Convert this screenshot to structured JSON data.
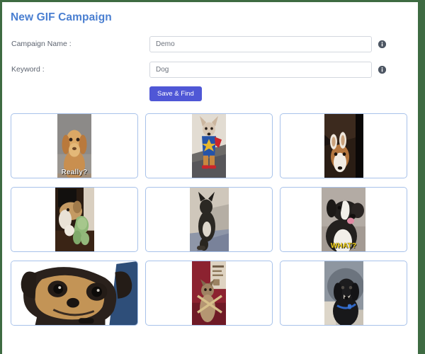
{
  "page": {
    "title": "New GIF Campaign",
    "frame_color": "#3e6b42",
    "title_color": "#4a7fd1",
    "accent_button_color": "#4f57d6",
    "card_border_color": "#a8c2ea"
  },
  "form": {
    "fields": [
      {
        "label": "Campaign Name :",
        "value": "Demo",
        "placeholder": "Demo",
        "info_icon": "info-circle-icon"
      },
      {
        "label": "Keyword :",
        "value": "Dog",
        "placeholder": "Dog",
        "info_icon": "info-circle-icon"
      }
    ],
    "submit_label": "Save & Find"
  },
  "results": {
    "cards": [
      {
        "id": "gif-1",
        "alt": "Tan vizsla puppy looking at camera",
        "caption": "Really?",
        "caption_style": "white",
        "thumb_width": "narrow"
      },
      {
        "id": "gif-2",
        "alt": "Chihuahua wearing superman costume on stairs",
        "caption": "",
        "caption_style": "none",
        "thumb_width": "narrow"
      },
      {
        "id": "gif-3",
        "alt": "Corgi upside down on dark background",
        "caption": "",
        "caption_style": "none",
        "thumb_width": "mid"
      },
      {
        "id": "gif-4",
        "alt": "Dog carrying a green plush toy",
        "caption": "",
        "caption_style": "none",
        "thumb_width": "mid"
      },
      {
        "id": "gif-5",
        "alt": "Black dog sitting upright on a couch",
        "caption": "",
        "caption_style": "none",
        "thumb_width": "mid"
      },
      {
        "id": "gif-6",
        "alt": "Black and white dog licking its nose",
        "caption": "WHAT?",
        "caption_style": "yellow",
        "thumb_width": "wide"
      },
      {
        "id": "gif-7",
        "alt": "Close-up of a chihuahua face",
        "caption": "",
        "caption_style": "none",
        "thumb_width": "full"
      },
      {
        "id": "gif-8",
        "alt": "Dog in front of a red backdrop",
        "caption": "",
        "caption_style": "none",
        "thumb_width": "narrow"
      },
      {
        "id": "gif-9",
        "alt": "Black spaniel wearing a blue collar",
        "caption": "",
        "caption_style": "none",
        "thumb_width": "mid"
      }
    ]
  }
}
